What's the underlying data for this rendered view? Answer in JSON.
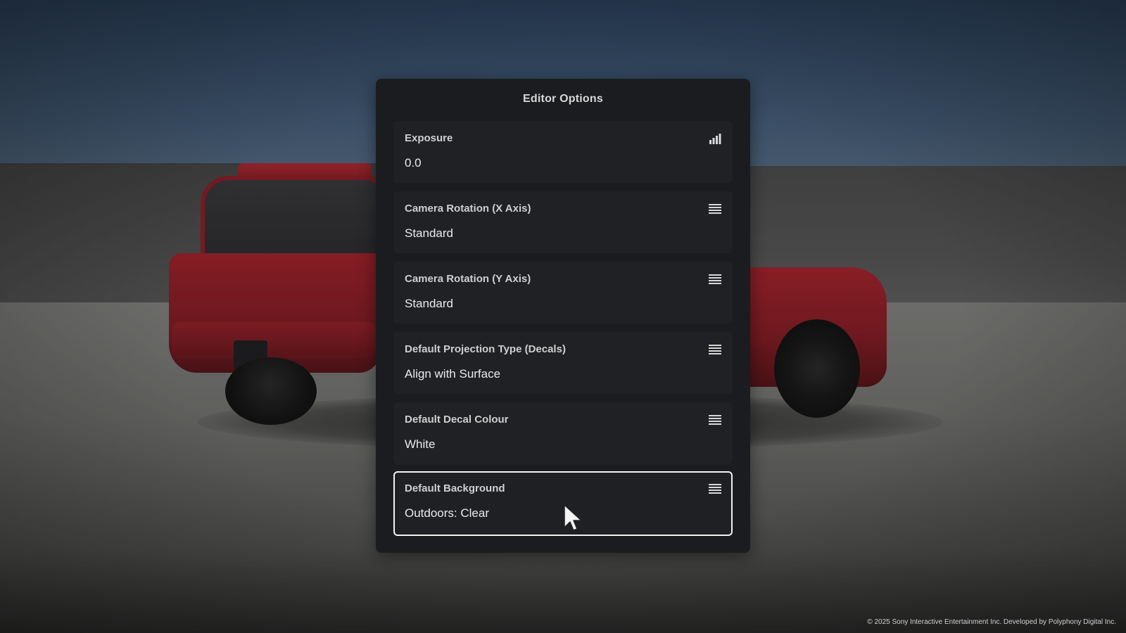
{
  "panel": {
    "title": "Editor Options",
    "options": [
      {
        "label": "Exposure",
        "value": "0.0",
        "icon": "level-bars-icon"
      },
      {
        "label": "Camera Rotation (X Axis)",
        "value": "Standard",
        "icon": "list-icon"
      },
      {
        "label": "Camera Rotation (Y Axis)",
        "value": "Standard",
        "icon": "list-icon"
      },
      {
        "label": "Default Projection Type (Decals)",
        "value": "Align with Surface",
        "icon": "list-icon"
      },
      {
        "label": "Default Decal Colour",
        "value": "White",
        "icon": "list-icon"
      },
      {
        "label": "Default Background",
        "value": "Outdoors: Clear",
        "icon": "list-icon",
        "selected": true
      }
    ]
  },
  "footer": {
    "copyright": "© 2025 Sony Interactive Entertainment Inc. Developed by Polyphony Digital Inc."
  },
  "colors": {
    "panel_bg": "#1b1c1f",
    "option_bg": "#202125",
    "selected_border": "#f2f2f2",
    "car_red": "#b0202a"
  }
}
